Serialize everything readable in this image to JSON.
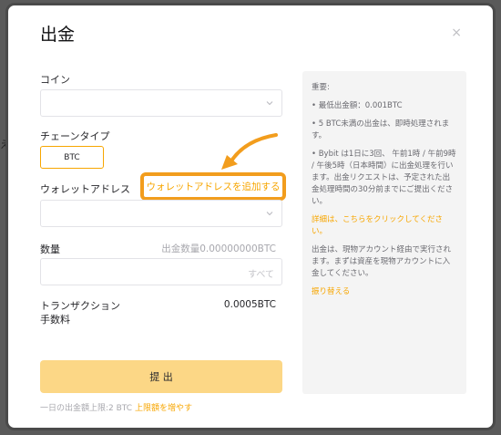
{
  "backdrop": {
    "left_char": "え"
  },
  "modal": {
    "title": "出金",
    "close_glyph": "×"
  },
  "form": {
    "coin_label": "コイン",
    "coin_value": "",
    "chain_label": "チェーンタイプ",
    "chain_option": "BTC",
    "address_label": "ウォレットアドレス",
    "add_address_link": "ウォレットアドレスを追加する",
    "address_value": "",
    "amount_label": "数量",
    "amount_balance": "出金数量0.00000000BTC",
    "amount_all": "すべて",
    "fee_label_line1": "トランザクション",
    "fee_label_line2": "手数料",
    "fee_value": "0.0005BTC",
    "submit_label": "提 出",
    "limit_text": "一日の出金額上限:2 BTC",
    "limit_link": "上限額を増やす"
  },
  "notice": {
    "heading": "重要:",
    "items": [
      "• 最低出金額：0.001BTC",
      "• 5 BTC未満の出金は、即時処理されます。",
      "• Bybit は1日に3回、 午前1時 / 午前9時 / 午後5時（日本時間）に出金処理を行います。出金リクエストは、予定された出金処理時間の30分前までにご提出ください。"
    ],
    "details_link": "詳細は、こちらをクリックしてください。",
    "spot_note": "出金は、現物アカウント経由で実行されます。まずは資産を現物アカウントに入金してください。",
    "transfer_link": "振り替える"
  },
  "colors": {
    "accent": "#f7a600",
    "highlight_border": "#f29d1d",
    "submit_bg": "#fcd786"
  }
}
